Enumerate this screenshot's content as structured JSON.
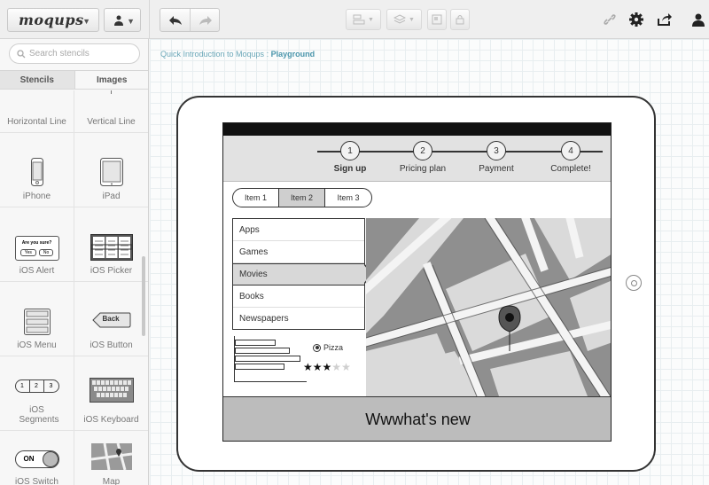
{
  "toolbar": {
    "logo": "moqups",
    "left_caret": "▼",
    "users_icon": "users-icon",
    "undo_icon": "undo-icon",
    "redo_icon": "redo-icon",
    "right_icons": [
      "link-icon",
      "gear-icon",
      "share-icon",
      "user-icon"
    ]
  },
  "sidebar": {
    "search_placeholder": "Search stencils",
    "tabs": [
      "Stencils",
      "Images"
    ],
    "stencils": [
      {
        "label": "Horizontal Line",
        "icon": "horizontal-line-icon"
      },
      {
        "label": "Vertical Line",
        "icon": "vertical-line-icon"
      },
      {
        "label": "iPhone",
        "icon": "iphone-icon"
      },
      {
        "label": "iPad",
        "icon": "ipad-icon"
      },
      {
        "label": "iOS Alert",
        "icon": "ios-alert-icon"
      },
      {
        "label": "iOS Picker",
        "icon": "ios-picker-icon"
      },
      {
        "label": "iOS Menu",
        "icon": "ios-menu-icon"
      },
      {
        "label": "iOS Button",
        "icon": "ios-button-icon"
      },
      {
        "label": "iOS Segments",
        "icon": "ios-segments-icon"
      },
      {
        "label": "iOS Keyboard",
        "icon": "ios-keyboard-icon"
      },
      {
        "label": "iOS Switch",
        "icon": "ios-switch-icon"
      },
      {
        "label": "Map",
        "icon": "map-icon"
      }
    ],
    "thumb_text": {
      "alert_title": "Are you sure?",
      "alert_yes": "Yes",
      "alert_no": "No",
      "back": "Back",
      "segments": [
        "1",
        "2",
        "3"
      ],
      "switch_on": "ON"
    }
  },
  "canvas": {
    "breadcrumb_path": "Quick Introduction to Moqups",
    "breadcrumb_sep": " : ",
    "breadcrumb_current": "Playground"
  },
  "mockup": {
    "steps": [
      {
        "num": "1",
        "label": "Sign up"
      },
      {
        "num": "2",
        "label": "Pricing plan"
      },
      {
        "num": "3",
        "label": "Payment"
      },
      {
        "num": "4",
        "label": "Complete!"
      }
    ],
    "segments": [
      "Item 1",
      "Item 2",
      "Item 3"
    ],
    "selected_segment": 1,
    "menu": [
      "Apps",
      "Games",
      "Movies",
      "Books",
      "Newspapers"
    ],
    "selected_menu": 2,
    "radio_label": "Pizza",
    "rating": 3,
    "rating_max": 5,
    "footer": "Wwwhat's new",
    "map_pin_icon": "map-pin-icon"
  },
  "colors": {
    "breadcrumb": "#6aa7b8",
    "map_base": "#8f8f8f",
    "screen_footer": "#bcbcbc"
  }
}
